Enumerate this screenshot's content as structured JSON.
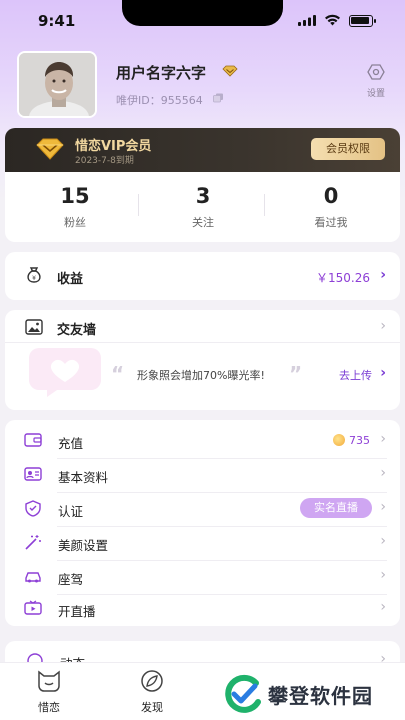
{
  "status_bar": {
    "time": "9:41"
  },
  "profile": {
    "username": "用户名字六字",
    "user_id": "唯伊ID：955564",
    "settings_label": "设置"
  },
  "vip": {
    "title": "惜恋VIP会员",
    "expiry": "2023-7-8到期",
    "privileges_button": "会员权限"
  },
  "stats": [
    {
      "value": "15",
      "label": "粉丝"
    },
    {
      "value": "3",
      "label": "关注"
    },
    {
      "value": "0",
      "label": "看过我"
    }
  ],
  "income": {
    "label": "收益",
    "value": "￥150.26"
  },
  "friend_wall": {
    "label": "交友墙",
    "slogan": "形象照会增加70%曝光率!",
    "upload_link": "去上传"
  },
  "menu": [
    {
      "label": "充值",
      "icon": "wallet-icon",
      "extra": "735"
    },
    {
      "label": "基本资料",
      "icon": "profile-card-icon"
    },
    {
      "label": "认证",
      "icon": "shield-check-icon",
      "badge": "实名直播"
    },
    {
      "label": "美颜设置",
      "icon": "magic-wand-icon"
    },
    {
      "label": "座驾",
      "icon": "car-icon"
    },
    {
      "label": "开直播",
      "icon": "live-tv-icon"
    }
  ],
  "peek_item": {
    "label": "动态"
  },
  "tabs": [
    {
      "label": "惜恋",
      "icon": "cat-face-icon"
    },
    {
      "label": "发现",
      "icon": "compass-icon"
    }
  ],
  "watermark": {
    "text": "攀登软件园"
  },
  "colors": {
    "accent": "#8d3fd6",
    "vip_gold": "#f2d8a0",
    "hero_top": "#dcc4fa"
  }
}
